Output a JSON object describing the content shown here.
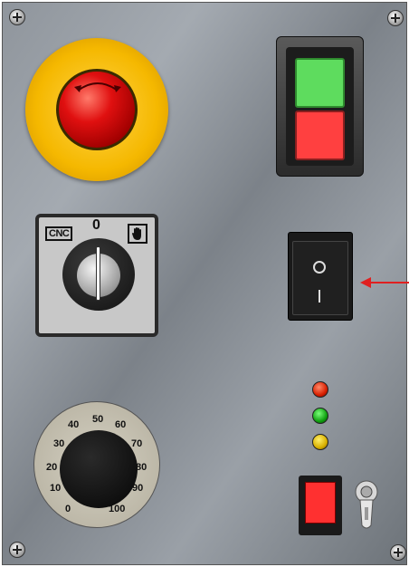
{
  "panel": {
    "emergency_stop": {
      "icon": "rotate-arrow-icon"
    },
    "start_stop": {
      "start_color": "#5edc5e",
      "stop_color": "#ff4040"
    },
    "mode_selector": {
      "label_left": "CNC",
      "label_center": "0",
      "label_right_icon": "hand-icon"
    },
    "rocker_switch": {
      "off_symbol": "O",
      "on_symbol": "I",
      "pointer_color": "#e02020"
    },
    "indicators": [
      {
        "name": "red",
        "color": "#e02020"
      },
      {
        "name": "green",
        "color": "#10a010"
      },
      {
        "name": "yellow",
        "color": "#d8b000"
      }
    ],
    "speed_dial": {
      "ticks": [
        "0",
        "10",
        "20",
        "30",
        "40",
        "50",
        "60",
        "70",
        "80",
        "90",
        "100"
      ]
    }
  }
}
